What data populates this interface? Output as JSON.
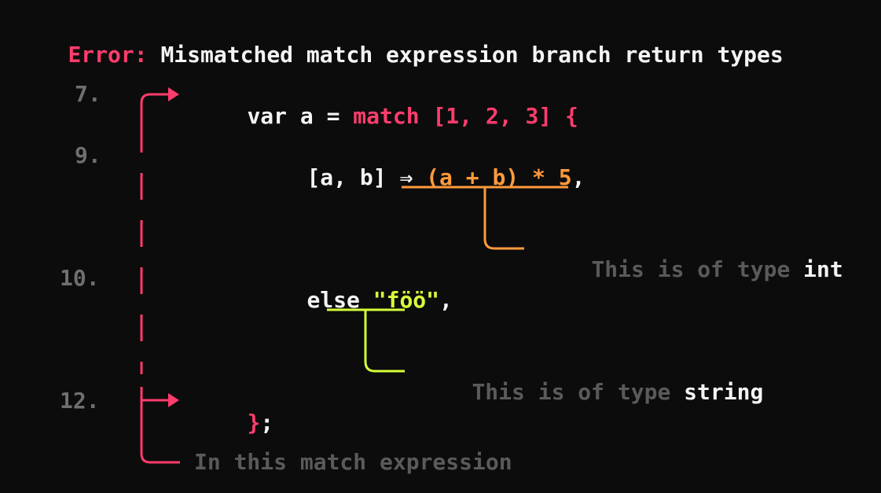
{
  "error": {
    "prefix": "Error:",
    "message": "Mismatched match expression branch return types"
  },
  "lines": [
    {
      "number": "7.",
      "tokens": {
        "var": "var a = ",
        "keyword": "match",
        "array": " [1, 2, 3] {"
      }
    },
    {
      "number": "9.",
      "tokens": {
        "pattern": "[a, b] ⇒ ",
        "expr": "(a + b) * 5",
        "comma": ","
      }
    },
    {
      "number": "10.",
      "tokens": {
        "else": "else ",
        "string": "\"föö\"",
        "comma": ","
      }
    },
    {
      "number": "12.",
      "tokens": {
        "brace": "}",
        "semi": ";"
      }
    }
  ],
  "annotations": {
    "int": {
      "prefix": "This is of type ",
      "type": "int",
      "color": "#ff9a3c"
    },
    "string": {
      "prefix": "This is of type ",
      "type": "string",
      "color": "#d6ff3a"
    },
    "match": {
      "text": "In this match expression",
      "color": "#ff3d6d"
    }
  }
}
